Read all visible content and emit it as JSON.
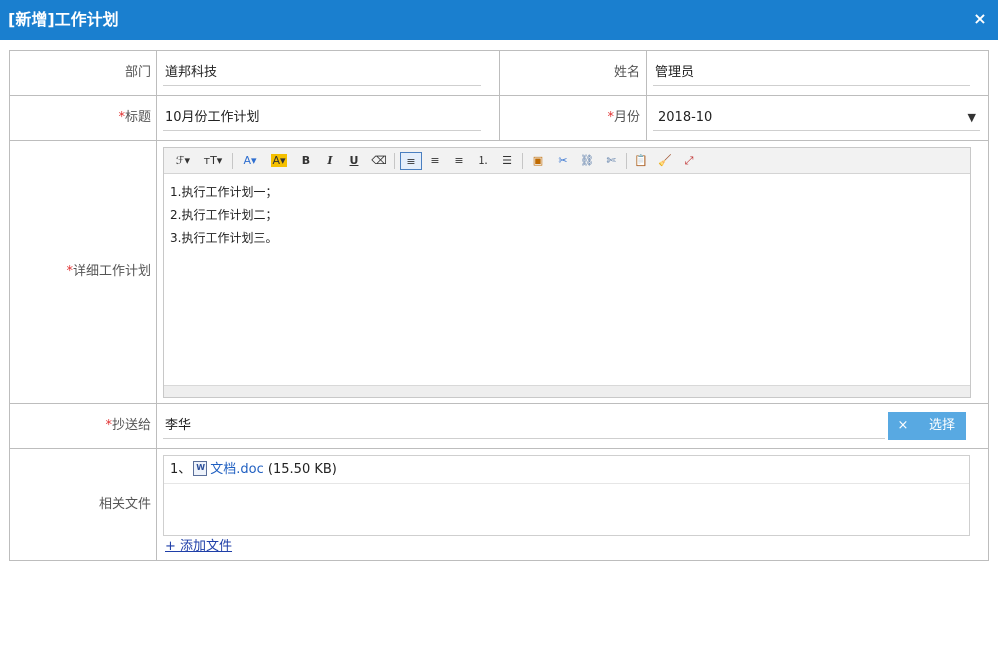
{
  "dialog": {
    "title": "[新增]工作计划",
    "close_label": "×"
  },
  "form": {
    "department": {
      "label": "部门",
      "value": "道邦科技"
    },
    "name": {
      "label": "姓名",
      "value": "管理员"
    },
    "title": {
      "required_mark": "*",
      "label": "标题",
      "value": "10月份工作计划"
    },
    "month": {
      "required_mark": "*",
      "label": "月份",
      "value": "2018-10",
      "arrow": "▼"
    },
    "detail": {
      "required_mark": "*",
      "label": "详细工作计划",
      "lines": [
        "1.执行工作计划一；",
        "2.执行工作计划二；",
        "3.执行工作计划三。"
      ]
    },
    "cc": {
      "required_mark": "*",
      "label": "抄送给",
      "value": "李华",
      "clear_label": "×",
      "choose_label": "选择"
    },
    "files": {
      "label": "相关文件",
      "items": [
        {
          "index": "1、",
          "name": "文档.doc",
          "size": "(15.50 KB)"
        }
      ],
      "add_label": "+ 添加文件"
    }
  },
  "toolbar": {
    "font_family": "ℱ▾",
    "font_size": "тT▾",
    "font_color": "A▾",
    "bg_color": "A▾",
    "bold": "B",
    "italic": "I",
    "underline": "U",
    "eraser": "⌫",
    "align_left": "≡",
    "align_center": "≡",
    "align_right": "≡",
    "ordered_list": "⒈",
    "unordered_list": "☰",
    "image": "▣",
    "cut": "✂",
    "link": "⛓",
    "unlink": "✄",
    "paste": "📋",
    "clean": "🧹",
    "fullscreen": "⤢"
  },
  "colors": {
    "titlebar": "#1a7fcf",
    "required": "#e03030",
    "button": "#58a9e2",
    "link": "#1f5fc1"
  }
}
